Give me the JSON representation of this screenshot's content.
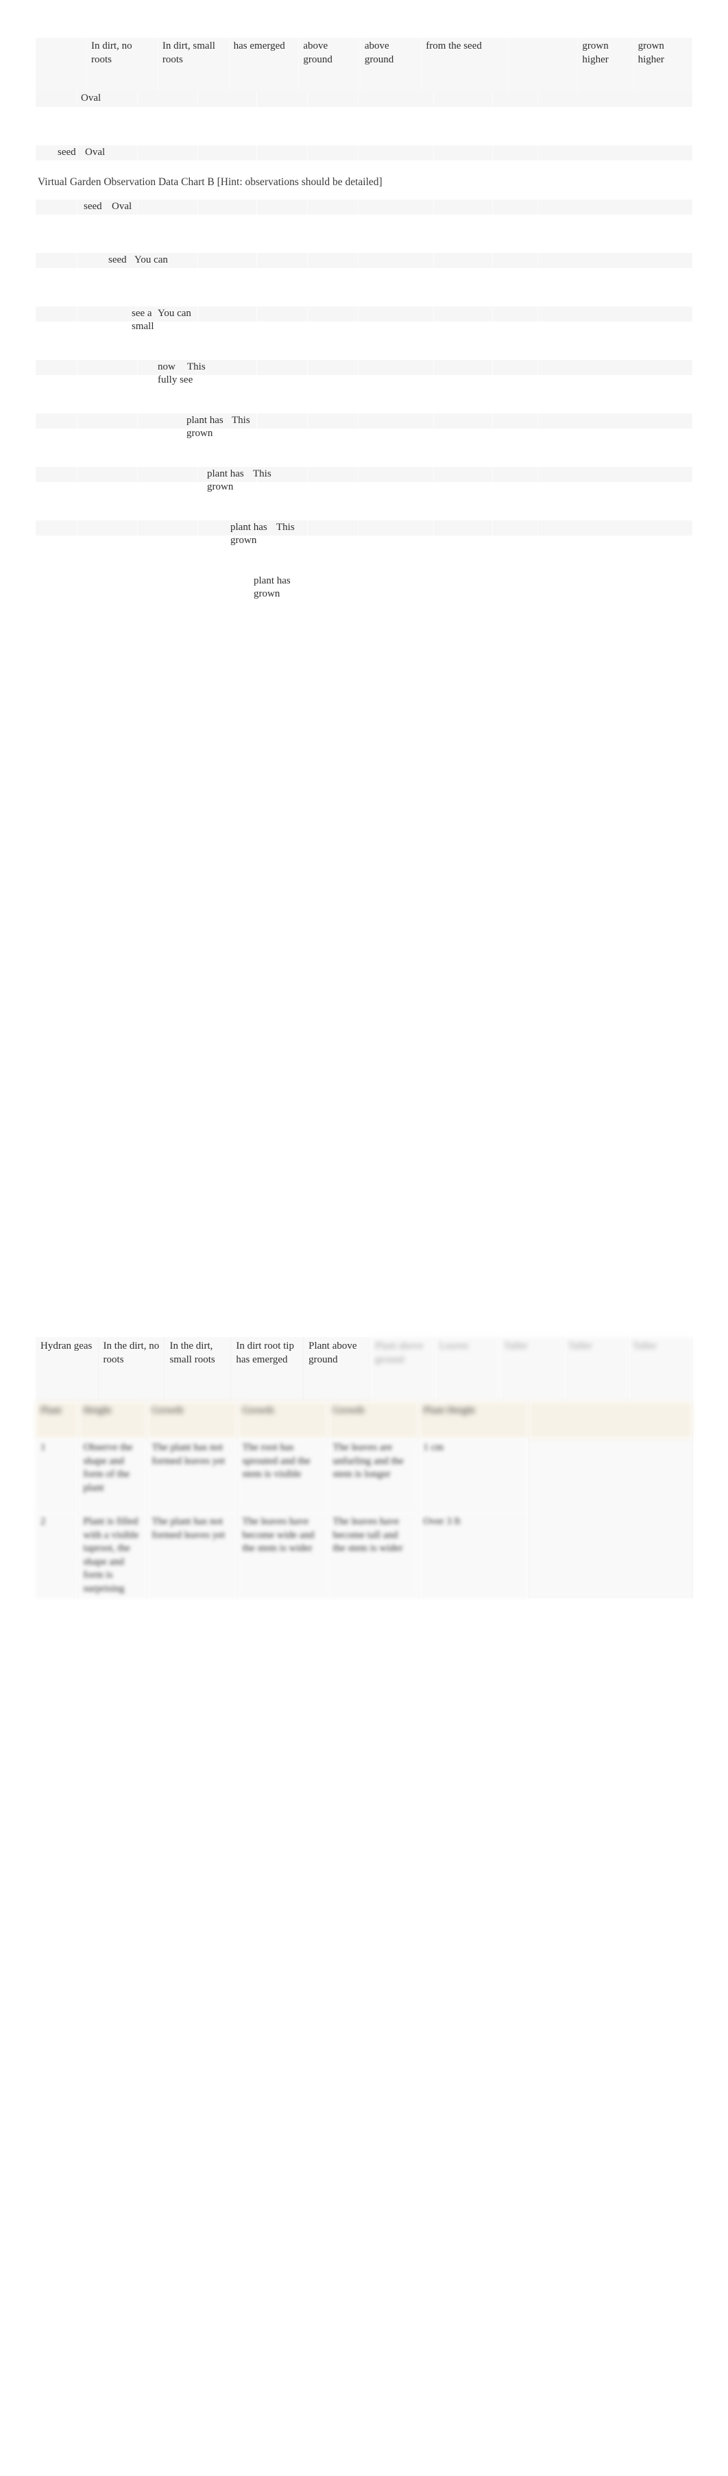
{
  "document": {
    "title_line": "Virtual Garden Observation Data Chart B  [Hint: observations should be detailed]",
    "title_main": "Virtual Garden Observation Data Chart B",
    "title_hint": "[Hint: observations should be detailed]"
  },
  "stage_header": {
    "columns": [
      {
        "label": ""
      },
      {
        "label": "In dirt,\nno roots"
      },
      {
        "label": "In dirt,\nsmall\nroots"
      },
      {
        "label": "has\nemerged"
      },
      {
        "label": "above\nground"
      },
      {
        "label": "above\nground"
      },
      {
        "label": "from the\nseed"
      },
      {
        "label": ""
      },
      {
        "label": "grown\nhigher"
      },
      {
        "label": "grown\nhigher"
      }
    ]
  },
  "fragment_rows": [
    {
      "id": "row-oval-1",
      "cells": [
        "",
        "Oval",
        "",
        "",
        "",
        "",
        "",
        "",
        "",
        ""
      ]
    },
    {
      "id": "row-seed-oval",
      "cells": [
        "",
        "seed",
        "Oval",
        "",
        "",
        "",
        "",
        "",
        "",
        ""
      ]
    },
    {
      "id": "row-seed-oval-2",
      "cells": [
        "",
        "",
        "seed",
        "Oval",
        "",
        "",
        "",
        "",
        "",
        ""
      ]
    },
    {
      "id": "row-seed-youcan",
      "cells": [
        "",
        "",
        "",
        "seed",
        "You can",
        "",
        "",
        "",
        "",
        ""
      ]
    },
    {
      "id": "row-seeasmall-youcan",
      "cells": [
        "",
        "",
        "",
        "",
        "see a\nsmall",
        "You can",
        "",
        "",
        "",
        ""
      ]
    },
    {
      "id": "row-nowfully-this",
      "cells": [
        "",
        "",
        "",
        "",
        "",
        "now\nfully see",
        "This",
        "",
        "",
        ""
      ]
    },
    {
      "id": "row-planthasgrown-this-1",
      "cells": [
        "",
        "",
        "",
        "",
        "",
        "",
        "plant has\ngrown",
        "This",
        "",
        ""
      ]
    },
    {
      "id": "row-planthasgrown-this-2",
      "cells": [
        "",
        "",
        "",
        "",
        "",
        "",
        "",
        "plant has\ngrown",
        "This",
        ""
      ]
    },
    {
      "id": "row-planthasgrown-this-3",
      "cells": [
        "",
        "",
        "",
        "",
        "",
        "",
        "",
        "",
        "plant has\ngrown",
        "This"
      ]
    },
    {
      "id": "row-planthasgrown-tail",
      "cells": [
        "",
        "",
        "",
        "",
        "",
        "",
        "",
        "",
        "",
        "plant has\ngrown"
      ]
    }
  ],
  "bottom_table": {
    "header_row": [
      "Hydran\ngeas",
      "In the\ndirt, no\nroots",
      "In the\ndirt,\nsmall\nroots",
      "In dirt\nroot tip\nhas\nemerged",
      "Plant\nabove\nground",
      "Plant\nabove\nground",
      "Leaves",
      "Taller",
      "Taller",
      "Taller"
    ],
    "column_header_row": [
      "Plant",
      "Height",
      "Growth",
      "Growth",
      "Growth",
      "Plant Height"
    ],
    "data_rows": [
      [
        "1",
        "Observe the shape and form of the plant",
        "The plant has not formed leaves yet",
        "The root has sprouted and the stem is visible",
        "The leaves are unfurling and the stem is longer",
        "1 cm"
      ],
      [
        "2",
        "Plant is filled with a visible taproot, the shape and form is surprising",
        "The plant has not formed leaves yet",
        "The leaves have become wide and the stem is wider",
        "The leaves have become tall and the stem is wider",
        "Over 3 ft"
      ]
    ]
  },
  "colors": {
    "page_bg": "#ffffff",
    "cell_bg": "#f7f7f7",
    "beige_bg": "#f7f2e7",
    "text": "#2e2e2e"
  }
}
